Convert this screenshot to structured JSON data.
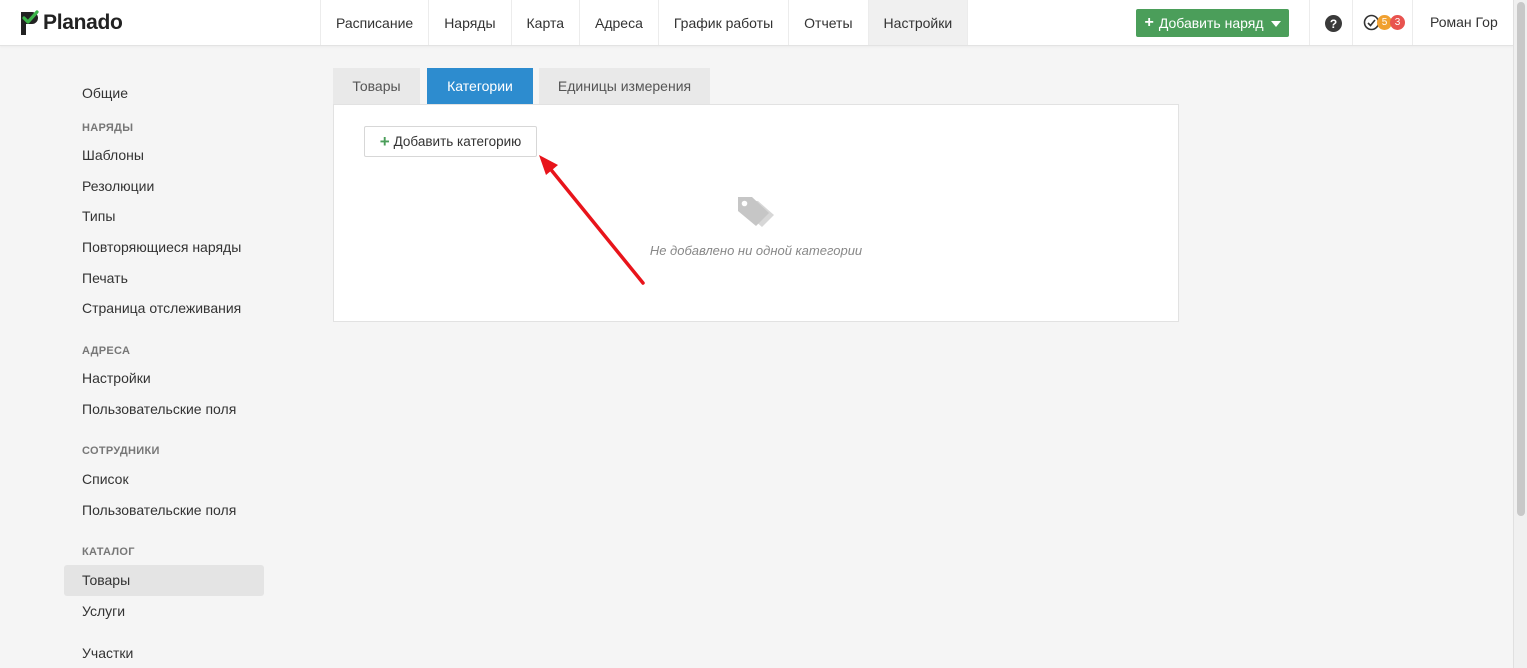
{
  "brand": {
    "name": "Planado"
  },
  "nav": [
    {
      "label": "Расписание"
    },
    {
      "label": "Наряды"
    },
    {
      "label": "Карта"
    },
    {
      "label": "Адреса"
    },
    {
      "label": "График работы"
    },
    {
      "label": "Отчеты"
    },
    {
      "label": "Настройки",
      "active": true
    }
  ],
  "header": {
    "add_order_label": "Добавить наряд",
    "help_icon": "question-circle-icon",
    "clock_icon": "clock-check-icon",
    "badge_orange": "5",
    "badge_red": "3",
    "user_name": "Роман Гор"
  },
  "sidebar": {
    "general": "Общие",
    "orders_head": "НАРЯДЫ",
    "orders": [
      "Шаблоны",
      "Резолюции",
      "Типы",
      "Повторяющиеся наряды",
      "Печать",
      "Страница отслеживания"
    ],
    "addresses_head": "АДРЕСА",
    "addresses": [
      "Настройки",
      "Пользовательские поля"
    ],
    "staff_head": "СОТРУДНИКИ",
    "staff": [
      "Список",
      "Пользовательские поля"
    ],
    "catalog_head": "КАТАЛОГ",
    "catalog": [
      "Товары",
      "Услуги"
    ],
    "areas": "Участки"
  },
  "tabs": [
    {
      "label": "Товары"
    },
    {
      "label": "Категории",
      "active": true
    },
    {
      "label": "Единицы измерения"
    }
  ],
  "content": {
    "add_category_label": "Добавить категорию",
    "empty_icon": "tags-icon",
    "empty_message": "Не добавлено ни одной категории"
  },
  "colors": {
    "accent_green": "#4b9e5a",
    "accent_blue": "#2d8ccf",
    "badge_orange": "#f0a030",
    "badge_red": "#e8534f",
    "annotation_arrow": "#e8141b"
  }
}
